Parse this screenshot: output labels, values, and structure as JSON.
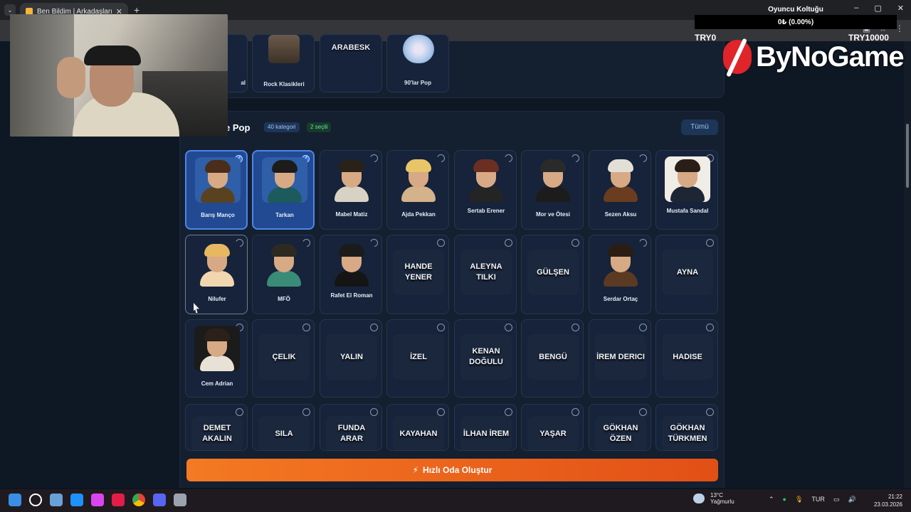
{
  "browser": {
    "tab_title": "Ben Bildim | Arkadaşlarınla Onl...",
    "tab_close": "✕",
    "new_tab": "+",
    "window_controls": [
      "–",
      "▢",
      "✕"
    ]
  },
  "stream_overlay": {
    "title": "Oyuncu Koltuğu",
    "amount": "0₺ (0.00%)",
    "min_label": "TRY0",
    "max_label": "TRY10000",
    "brand": "ByNoGame"
  },
  "top_row": {
    "cards": [
      {
        "label": "al",
        "type": "image"
      },
      {
        "label": "Rock Klasikleri",
        "type": "image"
      },
      {
        "label": "ARABESK",
        "type": "word"
      },
      {
        "label": "90'lar Pop",
        "type": "image"
      }
    ]
  },
  "section": {
    "title": "e Pop",
    "category_chip": "40 kategori",
    "selected_chip": "2 seçili",
    "all_button": "Tümü"
  },
  "artists": [
    {
      "name": "Barış Manço",
      "type": "avatar",
      "selected": true,
      "hair": "#4a2d1a",
      "torso": "#5a4220",
      "bg": "#2f5fa8"
    },
    {
      "name": "Tarkan",
      "type": "avatar",
      "selected": true,
      "hair": "#1c1c1c",
      "torso": "#1d5a5c",
      "bg": "#2f5fa8"
    },
    {
      "name": "Mabel Matiz",
      "type": "avatar",
      "selected": false,
      "hair": "#2a2119",
      "torso": "#d8d2c6",
      "bg": "#16233a"
    },
    {
      "name": "Ajda Pekkan",
      "type": "avatar",
      "selected": false,
      "hair": "#e9c56a",
      "torso": "#d4b28b",
      "bg": "#16233a"
    },
    {
      "name": "Sertab Erener",
      "type": "avatar",
      "selected": false,
      "hair": "#6b2f22",
      "torso": "#242424",
      "bg": "#16233a"
    },
    {
      "name": "Mor ve Ötesi",
      "type": "avatar",
      "selected": false,
      "hair": "#2a2a2a",
      "torso": "#1c1c1c",
      "bg": "#16233a"
    },
    {
      "name": "Sezen Aksu",
      "type": "avatar",
      "selected": false,
      "hair": "#e2e0d6",
      "torso": "#6a3c20",
      "bg": "#16233a"
    },
    {
      "name": "Mustafa Sandal",
      "type": "avatar",
      "selected": false,
      "hair": "#2a1f18",
      "torso": "#1e2533",
      "bg": "#f0ece6"
    },
    {
      "name": "Nilufer",
      "type": "avatar",
      "selected": false,
      "hover": true,
      "hair": "#e7b861",
      "torso": "#f2d6b0",
      "bg": "#16233a"
    },
    {
      "name": "MFÖ",
      "type": "avatar",
      "selected": false,
      "hair": "#2e2a22",
      "torso": "#3a8c78",
      "bg": "#16233a"
    },
    {
      "name": "Rafet El Roman",
      "type": "avatar",
      "selected": false,
      "hair": "#1b1b1b",
      "torso": "#151515",
      "bg": "#16233a"
    },
    {
      "name": "HANDE YENER",
      "type": "word",
      "selected": false
    },
    {
      "name": "ALEYNA TILKI",
      "type": "word",
      "selected": false
    },
    {
      "name": "GÜLŞEN",
      "type": "word",
      "selected": false
    },
    {
      "name": "Serdar Ortaç",
      "type": "avatar",
      "selected": false,
      "hair": "#2b1d14",
      "torso": "#5b3a24",
      "bg": "#16233a"
    },
    {
      "name": "AYNA",
      "type": "word",
      "selected": false
    },
    {
      "name": "Cem Adrian",
      "type": "avatar",
      "selected": false,
      "hair": "#2c2119",
      "torso": "#e8e2d6",
      "bg": "#1b1b1b"
    },
    {
      "name": "ÇELIK",
      "type": "word",
      "selected": false
    },
    {
      "name": "YALIN",
      "type": "word",
      "selected": false
    },
    {
      "name": "İZEL",
      "type": "word",
      "selected": false
    },
    {
      "name": "KENAN DOĞULU",
      "type": "word",
      "selected": false
    },
    {
      "name": "BENGÜ",
      "type": "word",
      "selected": false
    },
    {
      "name": "İREM DERICI",
      "type": "word",
      "selected": false
    },
    {
      "name": "HADISE",
      "type": "word",
      "selected": false
    },
    {
      "name": "DEMET AKALIN",
      "type": "word",
      "selected": false
    },
    {
      "name": "SILA",
      "type": "word",
      "selected": false
    },
    {
      "name": "FUNDA ARAR",
      "type": "word",
      "selected": false
    },
    {
      "name": "KAYAHAN",
      "type": "word",
      "selected": false
    },
    {
      "name": "İLHAN İREM",
      "type": "word",
      "selected": false
    },
    {
      "name": "YAŞAR",
      "type": "word",
      "selected": false
    },
    {
      "name": "GÖKHAN ÖZEN",
      "type": "word",
      "selected": false
    },
    {
      "name": "GÖKHAN TÜRKMEN",
      "type": "word",
      "selected": false
    }
  ],
  "cta": {
    "icon": "⚡",
    "label": "Hızlı Oda Oluştur"
  },
  "taskbar": {
    "weather_temp": "13°C",
    "weather_desc": "Yağmurlu",
    "lang": "TUR",
    "time": "21:22",
    "date": "23.03.2026",
    "icon_colors": [
      "#3a8ee6",
      "#ffffff",
      "#6aa0d8",
      "#1e90ff",
      "#d946ef",
      "#e11d48",
      "#fbbf24",
      "#5865f2",
      "#9ca3af"
    ]
  }
}
